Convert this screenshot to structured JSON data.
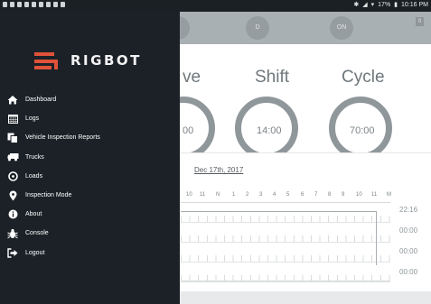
{
  "status_bar": {
    "left_icons": [
      "notification-icon",
      "notification-icon",
      "notification-icon",
      "notification-icon",
      "notification-icon",
      "notification-icon",
      "notification-icon",
      "notification-icon",
      "notification-icon"
    ],
    "battery": "17%",
    "time": "10:16 PM"
  },
  "top_bar": {
    "status_d": "D",
    "status_on": "ON",
    "corner_badge": "0"
  },
  "clocks": {
    "drive_title": "ve",
    "drive_value": "00",
    "shift_title": "Shift",
    "shift_value": "14:00",
    "cycle_title": "Cycle",
    "cycle_value": "70:00"
  },
  "log": {
    "date": "Dec 17th, 2017",
    "hours": [
      "10",
      "11",
      "N",
      "1",
      "2",
      "3",
      "4",
      "5",
      "6",
      "7",
      "8",
      "9",
      "10",
      "11",
      "M"
    ],
    "totals": [
      "22:16",
      "00:00",
      "00:00",
      "00:00"
    ]
  },
  "drawer": {
    "brand": "RIGBOT",
    "items": [
      {
        "label": "Dashboard",
        "icon": "home-icon"
      },
      {
        "label": "Logs",
        "icon": "calendar-icon"
      },
      {
        "label": "Vehicle Inspection Reports",
        "icon": "copy-documents-icon"
      },
      {
        "label": "Trucks",
        "icon": "truck-icon"
      },
      {
        "label": "Loads",
        "icon": "load-disc-icon"
      },
      {
        "label": "Inspection Mode",
        "icon": "map-marker-icon"
      },
      {
        "label": "About",
        "icon": "info-icon"
      },
      {
        "label": "Console",
        "icon": "bug-icon"
      },
      {
        "label": "Logout",
        "icon": "sign-out-icon"
      }
    ]
  },
  "colors": {
    "drawer_bg": "#1b2127",
    "brand_accent": "#e0523a",
    "ring": "#8f979b"
  }
}
